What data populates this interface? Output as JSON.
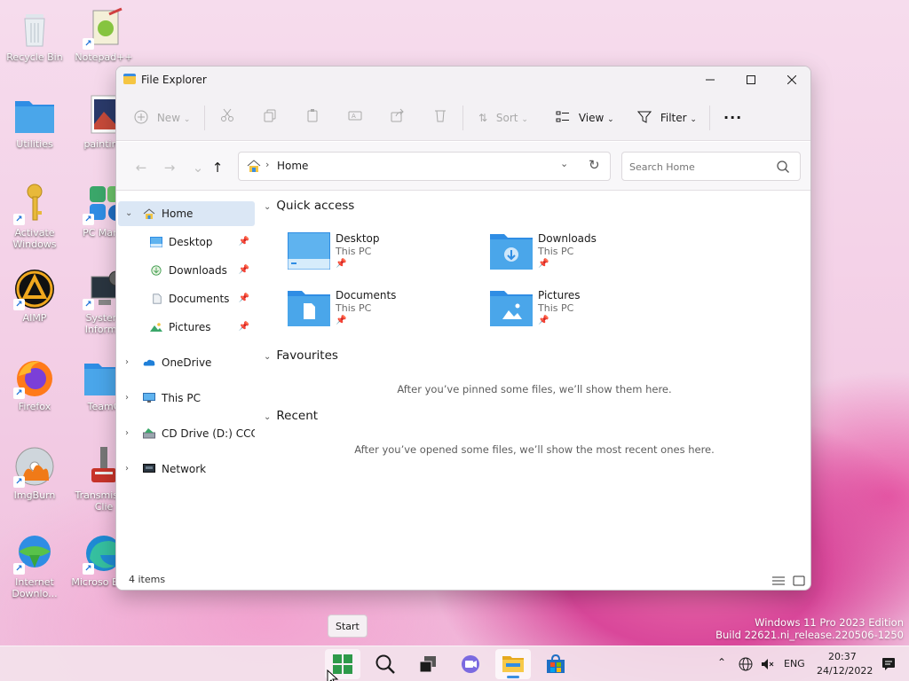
{
  "desktop": {
    "icons": [
      {
        "label": "Recycle Bin"
      },
      {
        "label": "Notepad++"
      },
      {
        "label": "Utilities"
      },
      {
        "label": "painting"
      },
      {
        "label": "Activate Windows"
      },
      {
        "label": "PC Mana"
      },
      {
        "label": "AIMP"
      },
      {
        "label": "System Informa"
      },
      {
        "label": "Firefox"
      },
      {
        "label": "TeamC"
      },
      {
        "label": "ImgBurn"
      },
      {
        "label": "Transmis Qt Clie"
      },
      {
        "label": "Internet Downlo..."
      },
      {
        "label": "Microso Edge"
      }
    ],
    "watermark": {
      "line1": "Windows 11 Pro 2023 Edition",
      "line2": "Build 22621.ni_release.220506-1250"
    }
  },
  "window": {
    "title": "File Explorer",
    "toolbar": {
      "new_label": "New",
      "sort_label": "Sort",
      "view_label": "View",
      "filter_label": "Filter"
    },
    "address": {
      "path_label": "Home"
    },
    "search": {
      "placeholder": "Search Home"
    },
    "nav": {
      "home": "Home",
      "desktop": "Desktop",
      "downloads": "Downloads",
      "documents": "Documents",
      "pictures": "Pictures",
      "onedrive": "OneDrive",
      "thispc": "This PC",
      "cddrive": "CD Drive (D:) CCCOM",
      "network": "Network"
    },
    "content": {
      "quick_access_title": "Quick access",
      "items": [
        {
          "name": "Desktop",
          "location": "This PC"
        },
        {
          "name": "Downloads",
          "location": "This PC"
        },
        {
          "name": "Documents",
          "location": "This PC"
        },
        {
          "name": "Pictures",
          "location": "This PC"
        }
      ],
      "favourites_title": "Favourites",
      "favourites_empty": "After you’ve pinned some files, we’ll show them here.",
      "recent_title": "Recent",
      "recent_empty": "After you’ve opened some files, we’ll show the most recent ones here."
    },
    "status": {
      "item_count": "4 items"
    }
  },
  "taskbar": {
    "start_tooltip": "Start",
    "language": "ENG",
    "time": "20:37",
    "date": "24/12/2022"
  },
  "colors": {
    "accent": "#3b8fe0",
    "folder_blue": "#4aa6ea",
    "nav_selected": "#dbe7f5"
  }
}
